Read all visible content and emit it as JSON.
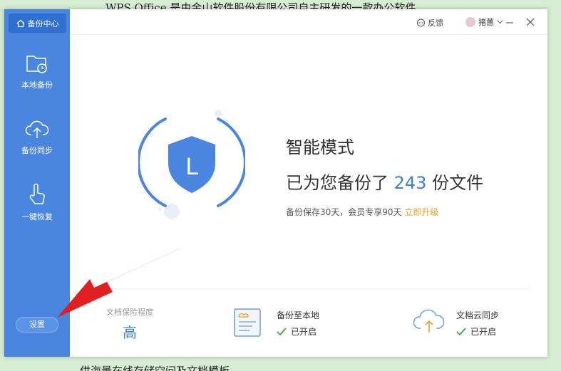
{
  "background": {
    "top_text": "WPS Office 是由金山软件股份有限公司自主研发的一款办公软件",
    "bottom_text": "供海量在线存储空间及文档模板"
  },
  "sidebar": {
    "header_label": "备份中心",
    "items": [
      {
        "label": "本地备份",
        "icon": "folder-clock-icon"
      },
      {
        "label": "备份同步",
        "icon": "cloud-upload-icon"
      },
      {
        "label": "一键恢复",
        "icon": "hand-pointer-icon"
      }
    ],
    "settings_label": "设置"
  },
  "titlebar": {
    "feedback_label": "反馈",
    "user_name": "猪蕙"
  },
  "main": {
    "shield_letter": "L",
    "mode_title": "智能模式",
    "count_prefix": "已为您备份了",
    "count_value": "243",
    "count_suffix": "份文件",
    "retention_text": "备份保存30天，会员专享90天",
    "upgrade_link": "立即升级"
  },
  "bottom": {
    "protection_label": "文档保险程度",
    "protection_value": "高",
    "local_backup_title": "备份至本地",
    "local_backup_status": "已开启",
    "sync_title": "文档云同步",
    "sync_status": "已开启"
  },
  "colors": {
    "sidebar_bg": "#4a86e0",
    "accent_blue": "#3b82d6",
    "upgrade_orange": "#f0a020",
    "arrow_red": "#e02020",
    "check_green": "#2eaa4a"
  }
}
